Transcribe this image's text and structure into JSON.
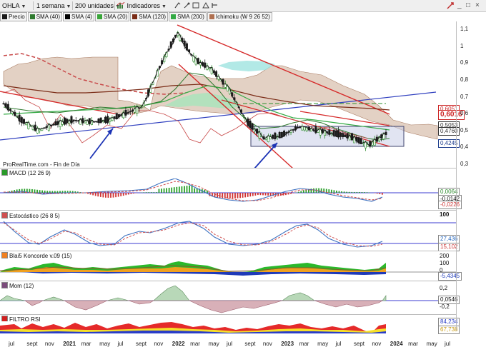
{
  "toolbar": {
    "ticker": "OHLA",
    "interval": "1 semana",
    "units": "200 unidades",
    "indicators": "Indicadores",
    "window_controls": [
      "_",
      "□",
      "×"
    ]
  },
  "legend": [
    {
      "label": "Precio",
      "color": "#1b1b1b"
    },
    {
      "label": "SMA (40)",
      "color": "#2f7a2f"
    },
    {
      "label": "SMA (4)",
      "color": "#000000"
    },
    {
      "label": "SMA (20)",
      "color": "#3aa63a"
    },
    {
      "label": "SMA (120)",
      "color": "#7a2b16"
    },
    {
      "label": "SMA (200)",
      "color": "#33aa44"
    },
    {
      "label": "Ichimoku (W 9 26 52)",
      "color": "#b07050"
    }
  ],
  "source": "ProRealTime.com - Fin de Día",
  "price_axis": [
    "1,1",
    "1",
    "0,9",
    "0,8",
    "0,7",
    "0,6",
    "0,5",
    "0,4",
    "0,3"
  ],
  "price_markers": [
    {
      "value": "0,6051",
      "color": "#cc2222"
    },
    {
      "value": "0,6016",
      "color": "#cc2222"
    },
    {
      "value": "0,5053",
      "color": "#333333"
    },
    {
      "value": "0,4760",
      "color": "#333333"
    },
    {
      "value": "0,4245",
      "color": "#1c3c8c"
    }
  ],
  "panels": {
    "macd": {
      "label": "MACD (12 26 9)",
      "values": [
        "0,0064",
        "-0,0142",
        "-0,0226"
      ]
    },
    "stochastic": {
      "label": "Estocástico (26 8 5)",
      "axis": [
        "100"
      ],
      "values": [
        "27,436",
        "15,102"
      ]
    },
    "koncorde": {
      "label": "Blai5 Koncorde v.09 (15)",
      "axis": [
        "200",
        "100",
        "0"
      ],
      "values": [
        "-5,4345"
      ]
    },
    "momentum": {
      "label": "Mom (12)",
      "axis": [
        "0,2",
        "-0,2"
      ],
      "values": [
        "0,0546"
      ]
    },
    "filtro_rsi": {
      "label": "FILTRO RSI",
      "values": [
        "84,234",
        "67,738"
      ]
    }
  },
  "x_axis": {
    "labels": [
      "jul",
      "sept",
      "nov",
      "2021",
      "mar",
      "may",
      "jul",
      "sept",
      "nov",
      "2022",
      "mar",
      "may",
      "jul",
      "sept",
      "nov",
      "2023",
      "mar",
      "may",
      "jul",
      "sept",
      "nov",
      "2024",
      "mar",
      "may",
      "jul"
    ],
    "years": [
      "2021",
      "2022",
      "2023",
      "2024"
    ]
  },
  "chart_data": {
    "type": "line",
    "title": "OHLA",
    "x": [
      "2020-07",
      "2020-09",
      "2020-11",
      "2021-01",
      "2021-03",
      "2021-05",
      "2021-07",
      "2021-09",
      "2021-11",
      "2022-01",
      "2022-02",
      "2022-03",
      "2022-05",
      "2022-07",
      "2022-09",
      "2022-11",
      "2023-01",
      "2023-03",
      "2023-05",
      "2023-07",
      "2023-09",
      "2023-11",
      "2023-12"
    ],
    "series": [
      {
        "name": "Precio",
        "values": [
          0.66,
          0.56,
          0.5,
          0.54,
          0.56,
          0.55,
          0.56,
          0.6,
          0.64,
          0.88,
          1.08,
          0.92,
          0.86,
          0.74,
          0.55,
          0.45,
          0.47,
          0.52,
          0.5,
          0.48,
          0.46,
          0.41,
          0.48
        ]
      }
    ],
    "ylim": [
      0.29,
      1.14
    ],
    "xlabel": "",
    "ylabel": ""
  }
}
